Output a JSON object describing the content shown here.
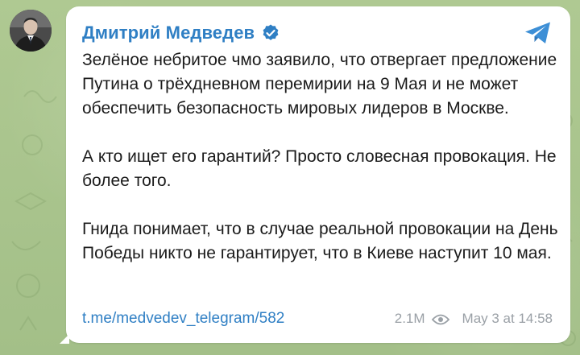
{
  "channel": {
    "name": "Дмитрий Медведев",
    "verified_icon": "verified-badge-icon",
    "share_icon": "telegram-share-icon",
    "accent_color": "#2f7fc4"
  },
  "post": {
    "paragraphs": [
      "Зелёное небритое чмо заявило, что отвергает предложение Путина о трёхдневном перемирии на 9 Мая и не может обеспечить безопасность мировых лидеров в Москве.",
      "А кто ищет его гарантий? Просто словесная провокация. Не более того.",
      "Гнида понимает, что в случае реальной провокации на День Победы никто не гарантирует, что в Киеве наступит 10 мая."
    ],
    "link": "t.me/medvedev_telegram/582",
    "views": "2.1M",
    "views_icon": "eye-icon",
    "timestamp": "May 3 at 14:58"
  }
}
